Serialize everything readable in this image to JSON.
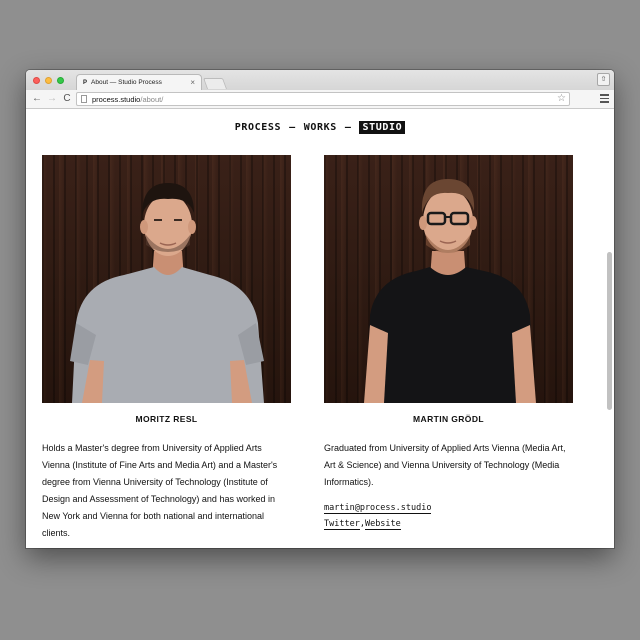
{
  "browser": {
    "tab_title": "About — Studio Process",
    "tab_favicon": "P",
    "tab_close": "×",
    "url_host": "process.studio",
    "url_path": "/about/",
    "back_icon": "←",
    "forward_icon": "→",
    "reload_icon": "C",
    "star_icon": "☆",
    "profile_icon": "⇧"
  },
  "site": {
    "nav": [
      "PROCESS",
      "WORKS",
      "STUDIO"
    ],
    "nav_separator": "—",
    "active_nav": "STUDIO"
  },
  "people": [
    {
      "name": "MORITZ RESL",
      "bio": "Holds a Master's degree from University of Applied Arts Vienna (Institute of Fine Arts and Media Art) and a Master's degree from Vienna University of Technology (Institute of Design and Assessment of Technology) and has worked in New York and Vienna for both national and international clients.",
      "shirt_color": "#a9acb2"
    },
    {
      "name": "MARTIN GRÖDL",
      "bio": "Graduated from University of Applied Arts Vienna (Media Art, Art & Science) and Vienna University of Technology (Media Informatics).",
      "email": "martin@process.studio",
      "links": [
        "Twitter",
        "Website"
      ],
      "link_separator": ",",
      "shirt_color": "#141416"
    }
  ],
  "colors": {
    "page_background": "#8f8f8f",
    "wood": "#2e1a12",
    "skin": "#d9a487"
  }
}
